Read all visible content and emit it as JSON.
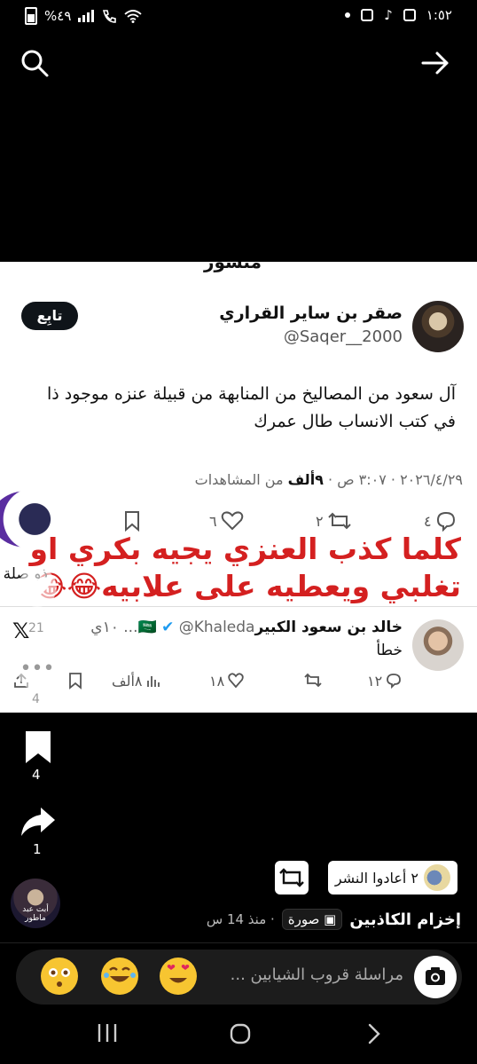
{
  "status_bar": {
    "time": "١:٥٢",
    "battery": "%٤٩",
    "icons": [
      "dot-icon",
      "calendar-icon",
      "tiktok-icon",
      "gallery-icon",
      "wifi-icon",
      "call-icon",
      "signal-icon",
      "battery-icon"
    ]
  },
  "story": {
    "header_partial": "منشور",
    "author_name": "صقر بن ساير القراري",
    "author_handle": "@Saqer__2000",
    "follow_label": "تابِع",
    "tweet_text": "آل سعود من المصاليخ من المنابهة من قبيلة عنزه موجود ذا في كتب الانساب طال عمرك",
    "meta_prefix": "٢٠٢٦/٤/٢٩ · ٣:٠٧ ص · ",
    "views_count": "٩ألف",
    "views_suffix": " من المشاهدات",
    "replies": "٤",
    "reposts": "٢",
    "likes": "٦",
    "overlay_text": "كلما كذب العنزي يجيه بكري او تغلبي ويعطيه على علابيه😂😂",
    "related_label": "ذو صلة",
    "reply_author": "خالد بن سعود الكبير🇸🇦",
    "reply_handle": "@Khaleda...",
    "reply_time": "١٠ي",
    "reply_text": "خطأ",
    "reply_replies": "١٢",
    "reply_likes": "١٨",
    "reply_views": "٨ألف",
    "x_logo": "𝕏"
  },
  "side": {
    "likes_count": "21",
    "comments_count": "4",
    "bookmarks_count": "4",
    "shares_count": "1"
  },
  "repost": {
    "label": "٢ أعادوا النشر"
  },
  "caption": {
    "title": "إخزام الكاذبين",
    "chip": "صورة",
    "time": "منذ 14 س",
    "profile_text": "أبت عبد ماطور"
  },
  "message_bar": {
    "placeholder": "مراسلة قروب الشيابين ...",
    "emojis": [
      "😳",
      "😂",
      "😍"
    ]
  }
}
